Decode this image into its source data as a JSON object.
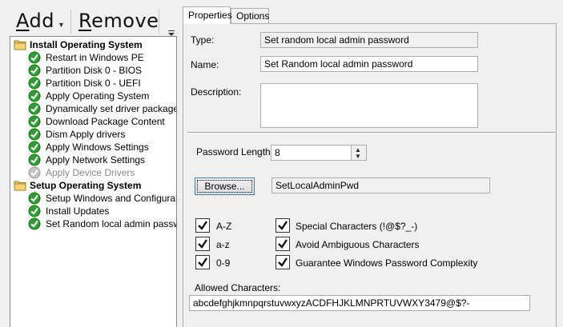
{
  "toolbar": {
    "add_label": "Add",
    "remove_label": "Remove"
  },
  "tree": {
    "groups": [
      {
        "label": "Install Operating System",
        "icon": "folder-icon",
        "children": [
          {
            "label": "Restart in Windows PE",
            "status": "ok"
          },
          {
            "label": "Partition Disk 0 - BIOS",
            "status": "ok"
          },
          {
            "label": "Partition Disk 0 - UEFI",
            "status": "ok"
          },
          {
            "label": "Apply Operating System",
            "status": "ok"
          },
          {
            "label": "Dynamically set driver package to",
            "status": "ok"
          },
          {
            "label": "Download Package Content",
            "status": "ok"
          },
          {
            "label": "Dism Apply drivers",
            "status": "ok"
          },
          {
            "label": "Apply Windows Settings",
            "status": "ok"
          },
          {
            "label": "Apply Network Settings",
            "status": "ok"
          },
          {
            "label": "Apply Device Drivers",
            "status": "disabled"
          }
        ]
      },
      {
        "label": "Setup Operating System",
        "icon": "folder-icon",
        "children": [
          {
            "label": "Setup Windows and Configuration",
            "status": "ok"
          },
          {
            "label": "Install Updates",
            "status": "ok"
          },
          {
            "label": "Set Random local admin password",
            "status": "ok"
          }
        ]
      }
    ]
  },
  "tabs": {
    "properties": "Properties",
    "options": "Options"
  },
  "properties": {
    "type_label": "Type:",
    "type_value": "Set random local admin password",
    "name_label": "Name:",
    "name_value": "Set Random local admin password",
    "description_label": "Description:",
    "description_value": ""
  },
  "settings": {
    "password_length_label": "Password Length:",
    "password_length_value": "8",
    "browse_label": "Browse...",
    "variable_value": "SetLocalAdminPwd",
    "checks": {
      "az": {
        "label": "A-Z",
        "checked": true
      },
      "az_lower": {
        "label": "a-z",
        "checked": true
      },
      "digits": {
        "label": "0-9",
        "checked": true
      },
      "special": {
        "label": "Special Characters (!@$?_-)",
        "checked": true
      },
      "ambiguous": {
        "label": "Avoid Ambiguous Characters",
        "checked": true
      },
      "complexity": {
        "label": "Guarantee Windows Password Complexity",
        "checked": true
      }
    },
    "allowed_label": "Allowed Characters:",
    "allowed_value": "abcdefghjkmnpqrstuvwxyzACDFHJKLMNPRTUVWXY3479@$?-"
  },
  "colors": {
    "ok_green": "#2f9e2f",
    "panel_bg": "#f0f0f0",
    "border": "#adadad"
  }
}
